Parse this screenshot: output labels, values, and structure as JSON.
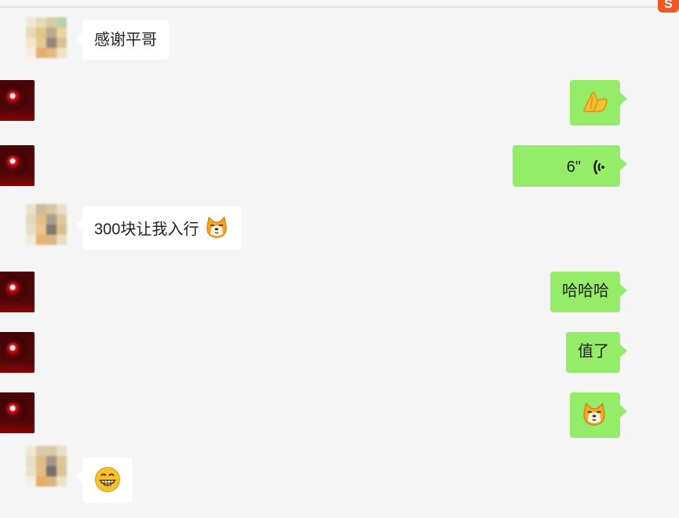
{
  "window": {
    "corner_badge": "S",
    "background": "#f5f5f5"
  },
  "messages": [
    {
      "sender": "left",
      "text": "感谢平哥",
      "avatar": "pixelated-avatar-icon"
    },
    {
      "sender": "right",
      "text": "",
      "emoji": "namaste-icon",
      "avatar": "red-sphere-avatar-icon"
    },
    {
      "sender": "right",
      "text": "6\"",
      "voice": true,
      "avatar": "red-sphere-avatar-icon"
    },
    {
      "sender": "left",
      "text": "300块让我入行",
      "emoji": "shiba-doge-icon",
      "avatar": "pixelated-avatar-icon"
    },
    {
      "sender": "right",
      "text": "哈哈哈",
      "avatar": "red-sphere-avatar-icon"
    },
    {
      "sender": "right",
      "text": "值了",
      "avatar": "red-sphere-avatar-icon"
    },
    {
      "sender": "right",
      "text": "",
      "emoji": "shiba-doge-icon",
      "avatar": "red-sphere-avatar-icon"
    },
    {
      "sender": "left",
      "text": "",
      "emoji": "grinning-face-icon",
      "avatar": "pixelated-avatar-icon"
    }
  ],
  "colors": {
    "self_bubble": "#95ec69",
    "other_bubble": "#ffffff"
  }
}
